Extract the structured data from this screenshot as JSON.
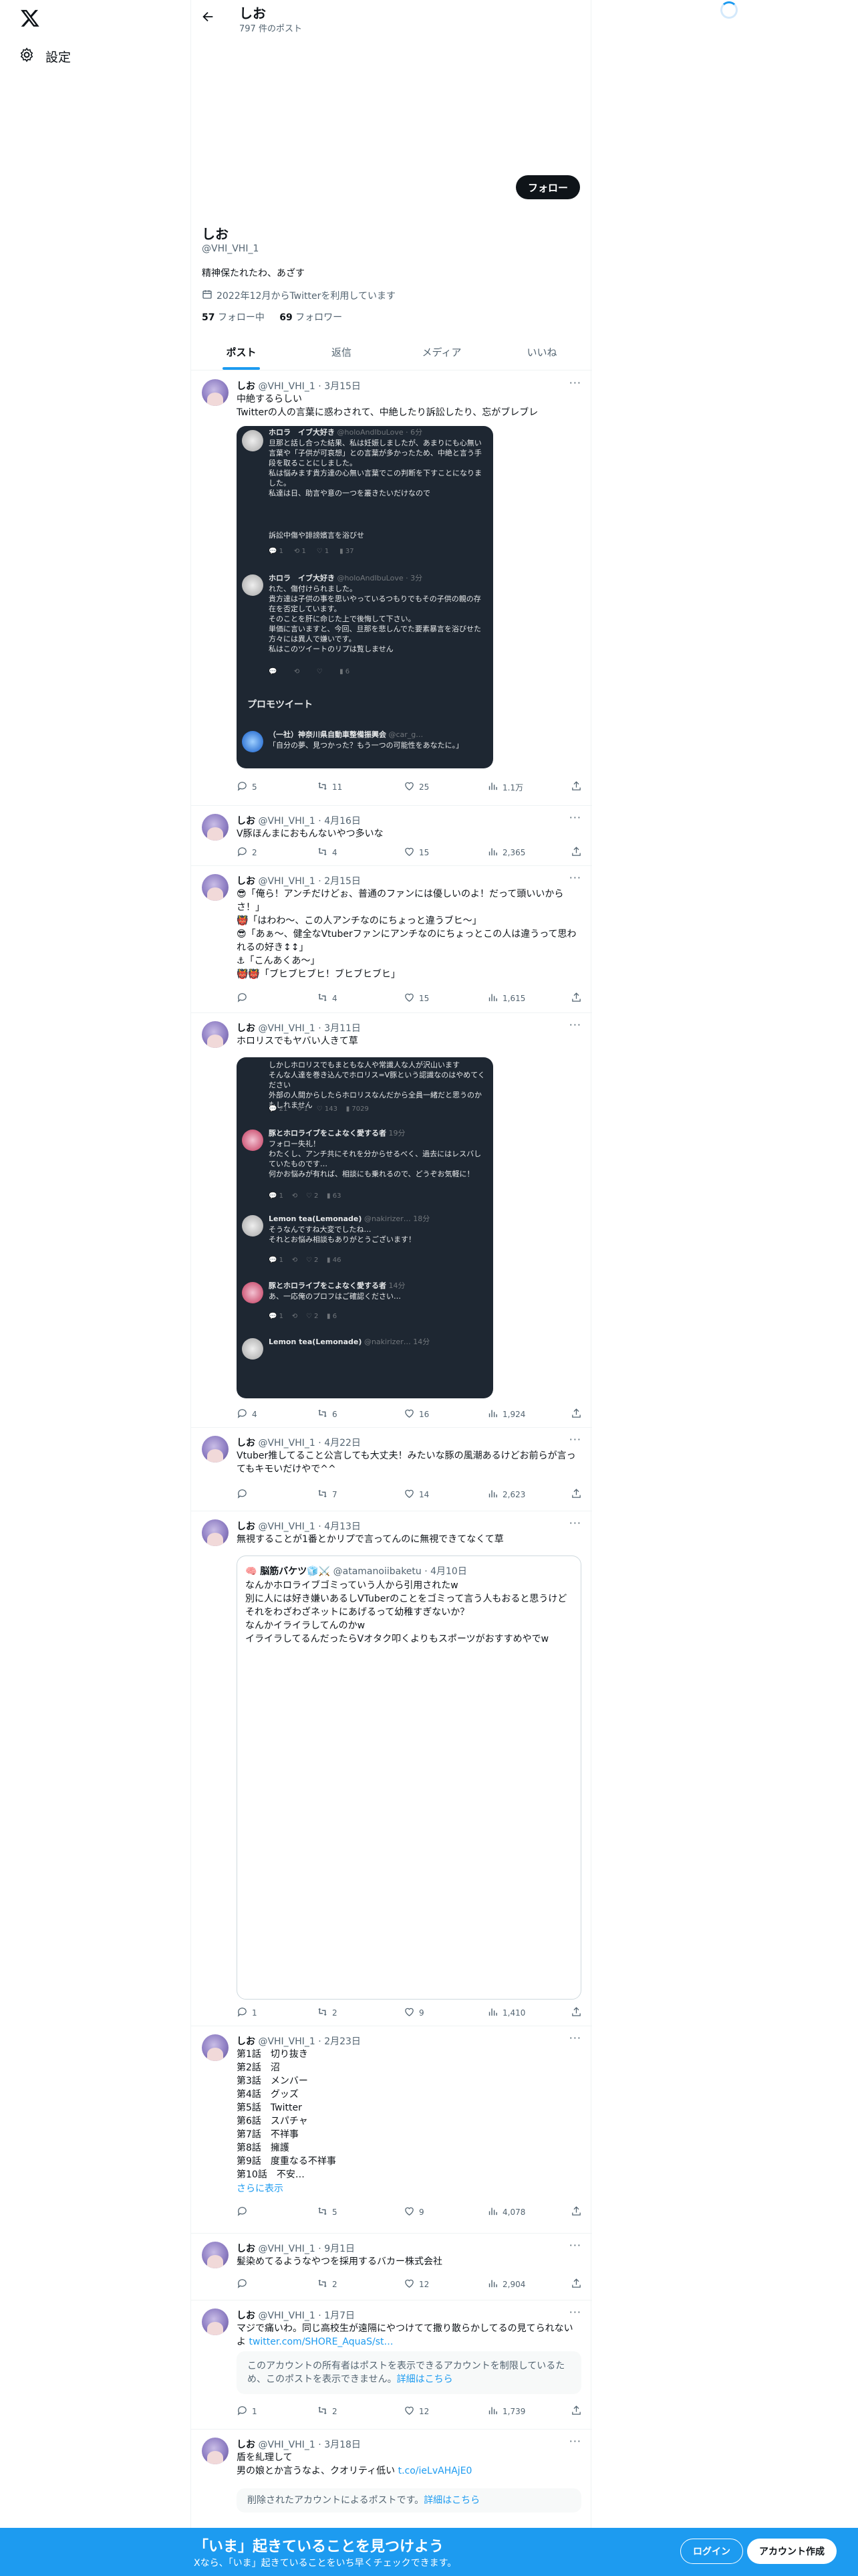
{
  "nav": {
    "settings": "設定"
  },
  "header": {
    "name": "しお",
    "post_count": "797 件のポスト"
  },
  "profile": {
    "name": "しお",
    "handle": "@VHI_VHI_1",
    "bio": "精神保たれたわ、あざす",
    "joined": "2022年12月からTwitterを利用しています",
    "following_count": "57",
    "following_label": "フォロー中",
    "followers_count": "69",
    "followers_label": "フォロワー",
    "follow_button": "フォロー"
  },
  "tabs": [
    "ポスト",
    "返信",
    "メディア",
    "いいね"
  ],
  "tweets": [
    {
      "name": "しお",
      "handle": "@VHI_VHI_1",
      "date": "3月15日",
      "text": "中絶するらしい\nTwitterの人の言葉に惑わされて、中絶したり訴訟したり、忘がブレブレ",
      "replies": "5",
      "retweets": "11",
      "likes": "25",
      "views": "1.1万"
    },
    {
      "name": "しお",
      "handle": "@VHI_VHI_1",
      "date": "4月16日",
      "text": "V豚ほんまにおもんないやつ多いな",
      "replies": "2",
      "retweets": "4",
      "likes": "15",
      "views": "2,365"
    },
    {
      "name": "しお",
      "handle": "@VHI_VHI_1",
      "date": "2月15日",
      "text": "😎「俺ら！アンチだけどぉ、普通のファンには優しいのよ！だって頭いいからさ！」\n👹「はわわ〜、この人アンチなのにちょっと違うブヒ〜」\n😎「あぁ〜、健全なVtuberファンにアンチなのにちょっとこの人は違うって思われるの好き↕↕」\n⚓「こんあくあ〜」\n👹👹「ブヒブヒブヒ！ブヒブヒブヒ」",
      "replies": "",
      "retweets": "4",
      "likes": "15",
      "views": "1,615"
    },
    {
      "name": "しお",
      "handle": "@VHI_VHI_1",
      "date": "3月11日",
      "text": "ホロリスでもヤバい人きて草",
      "replies": "4",
      "retweets": "6",
      "likes": "16",
      "views": "1,924"
    },
    {
      "name": "しお",
      "handle": "@VHI_VHI_1",
      "date": "4月22日",
      "text": "Vtuber推してること公言しても大丈夫！みたいな豚の風潮あるけどお前らが言ってもキモいだけやで^^",
      "replies": "",
      "retweets": "7",
      "likes": "14",
      "views": "2,623"
    },
    {
      "name": "しお",
      "handle": "@VHI_VHI_1",
      "date": "4月13日",
      "text": "無視することが1番とかリプで言ってんのに無視できてなくて草",
      "replies": "1",
      "retweets": "2",
      "likes": "9",
      "views": "1,410"
    },
    {
      "name": "しお",
      "handle": "@VHI_VHI_1",
      "date": "2月23日",
      "text": "第1話　切り抜き\n第2話　沼\n第3話　メンバー\n第4話　グッズ\n第5話　Twitter\n第6話　スパチャ\n第7話　不祥事\n第8話　擁護\n第9話　度重なる不祥事\n第10話　不安…",
      "show_more": "さらに表示",
      "replies": "",
      "retweets": "5",
      "likes": "9",
      "views": "4,078"
    },
    {
      "name": "しお",
      "handle": "@VHI_VHI_1",
      "date": "9月1日",
      "text": "髪染めてるようなやつを採用するバカー株式会社",
      "replies": "",
      "retweets": "2",
      "likes": "12",
      "views": "2,904"
    },
    {
      "name": "しお",
      "handle": "@VHI_VHI_1",
      "date": "1月7日",
      "text": "マジで痛いわ。同じ高校生が遠隔にやつけてて撒り散らかしてるの見てられないよ ",
      "link": "twitter.com/SHORE_AquaS/st…",
      "notice": "このアカウントの所有者はポストを表示できるアカウントを制限しているため、このポストを表示できません。",
      "notice_link": "詳細はこちら",
      "replies": "1",
      "retweets": "2",
      "likes": "12",
      "views": "1,739"
    },
    {
      "name": "しお",
      "handle": "@VHI_VHI_1",
      "date": "3月18日",
      "text": "盾を糺理して\n男の娘とか言うなよ、クオリティ低い ",
      "link": "t.co/ieLvAHAjE0",
      "notice": "削除されたアカウントによるポストです。",
      "notice_link": "詳細はこちら",
      "replies": "",
      "retweets": "",
      "likes": "",
      "views": ""
    }
  ],
  "embed1": {
    "t1_name": "ホロラ　イブ大好き",
    "t1_handle": "@holoAndIbuLove · 6分",
    "t1_text": "旦那と話し合った結果、私は妊娠しましたが、あまりにも心無い言葉や「子供が可哀想」との言葉が多かったため、中絶と言う手段を取ることにしました。\n私は悩みます貴方達の心無い言葉でこの判断を下すことになりました。\n私達は日、助言や意の一つを叢きたいだけなので",
    "t1_foot": "訴訟中傷や誹謗嬪言を浴びせ",
    "t1_stats": [
      "1",
      "1",
      "1",
      "37"
    ],
    "t2_name": "ホロラ　イブ大好き",
    "t2_handle": "@holoAndIbuLove · 3分",
    "t2_text": "れた、傷付けられました。\n貴方達は子供の事を思いやっているつもりでもその子供の親の存在を否定しています。\nそのことを肝に命じた上で後悔して下さい。\n単価に言いますと、今回、旦那を悲しんでた要素暴言を浴びせた方々には異人で嫌いです。\n私はこのツイートのリプは覧しません",
    "t2_stats": [
      "6"
    ],
    "promo_title": "プロモツイート",
    "promo_name": "（一社）神奈川県自動車整備振興会",
    "promo_handle": "@car_g…",
    "promo_text": "「自分の夢、見つかった？もう一つの可能性をあなたに。」"
  },
  "embed2": {
    "top_text": "しかしホロリスでもまともな人や常識人な人が沢山います\nそんな人達を巻き込んでホロリス=V豚という認識なのはやめてください\n外部の人間からしたらホロリスなんだから全員一緒だと思うのかもしれません",
    "top_stats": [
      "21",
      "1",
      "143",
      "7029"
    ],
    "r1_name": "豚とホロライブをこよなく愛する者",
    "r1_time": "19分",
    "r1_text": "フォロー失礼！\nわたくし、アンチ共にそれを分からせるべく、過去にはレスバしていたものです…\n何かお悩みが有れば、相談にも乗れるので、どうぞお気軽に！",
    "r1_stats": [
      "1",
      "",
      "2",
      "63"
    ],
    "r2_name": "Lemon tea(Lemonade)",
    "r2_handle": "@nakirizer… 18分",
    "r2_text": "そうなんですね大変でしたね…\nそれとお悩み相談もありがとうございます！",
    "r2_stats": [
      "1",
      "",
      "2",
      "46"
    ],
    "r3_name": "豚とホロライブをこよなく愛する者",
    "r3_time": "14分",
    "r3_text": "あ、一応俺のプロフはご確認ください…",
    "r3_stats": [
      "1",
      "",
      "2",
      "6"
    ],
    "r4_name": "Lemon tea(Lemonade)",
    "r4_handle": "@nakirizer… 14分"
  },
  "quote": {
    "name": "🧠 脳筋バケツ",
    "badges": "🧊⚔️",
    "handle": "@atamanoiibaketu · 4月10日",
    "text": "なんかホロライブゴミっていう人から引用されたw\n別に人には好き嫌いあるしVTuberのことをゴミって言う人もおると思うけどそれをわざわざネットにあげるって幼稚すぎないか？\nなんかイライラしてんのかw\nイライラしてるんだったらVオタク叩くよりもスポーツがおすすめやでw"
  },
  "bottom_bar": {
    "title": "「いま」起きていることを見つけよう",
    "subtitle": "Xなら、「いま」起きていることをいち早くチェックできます。",
    "login": "ログイン",
    "signup": "アカウント作成"
  }
}
